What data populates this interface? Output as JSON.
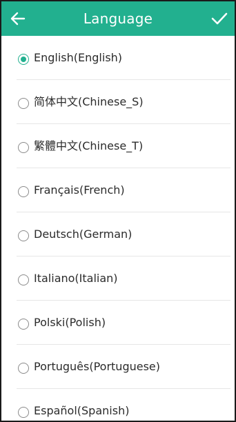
{
  "header": {
    "title": "Language",
    "back_icon": "arrow-left-icon",
    "confirm_icon": "checkmark-icon",
    "bar_color": "#22b08f"
  },
  "languages": [
    {
      "label": "English(English)",
      "selected": true
    },
    {
      "label": "简体中文(Chinese_S)",
      "selected": false
    },
    {
      "label": "繁體中文(Chinese_T)",
      "selected": false
    },
    {
      "label": "Français(French)",
      "selected": false
    },
    {
      "label": "Deutsch(German)",
      "selected": false
    },
    {
      "label": "Italiano(Italian)",
      "selected": false
    },
    {
      "label": "Polski(Polish)",
      "selected": false
    },
    {
      "label": "Português(Portuguese)",
      "selected": false
    },
    {
      "label": "Español(Spanish)",
      "selected": false
    }
  ]
}
